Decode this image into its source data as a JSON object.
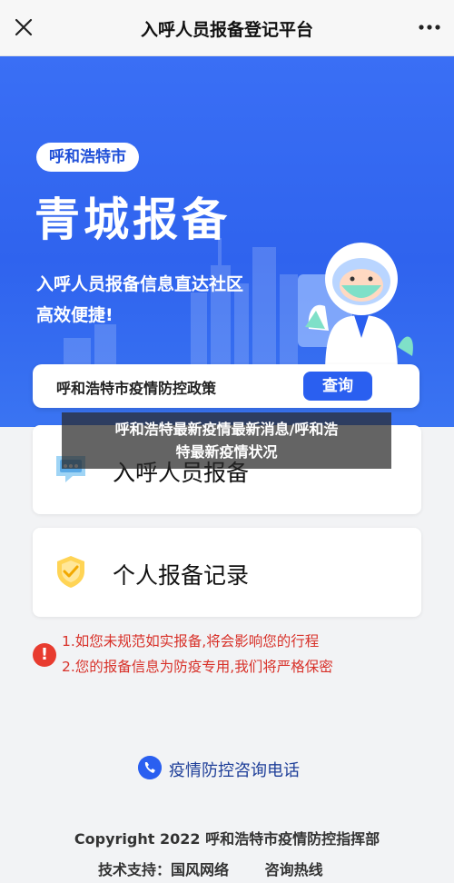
{
  "topbar": {
    "title": "入呼人员报备登记平台"
  },
  "hero": {
    "city_tag": "呼和浩特市",
    "title": "青城报备",
    "subtitle_1": "入呼人员报备信息直达社区",
    "subtitle_2": "高效便捷!"
  },
  "policy": {
    "label": "呼和浩特市疫情防控政策",
    "button": "查询"
  },
  "overlay": {
    "line1": "呼和浩特最新疫情最新消息/呼和浩",
    "line2": "特最新疫情状况"
  },
  "cards": [
    {
      "label": "入呼人员报备",
      "icon": "chat-icon"
    },
    {
      "label": "个人报备记录",
      "icon": "shield-check-icon"
    }
  ],
  "notice": {
    "line1": "1.如您未规范如实报备,将会影响您的行程",
    "line2": "2.您的报备信息为防疫专用,我们将严格保密"
  },
  "hotline": {
    "label": "疫情防控咨询电话"
  },
  "footer": {
    "copyright": "Copyright 2022 呼和浩特市疫情防控指挥部",
    "tech": "技术支持：国风网络",
    "consult": "咨询热线"
  },
  "colors": {
    "primary": "#2a5ff0",
    "warn": "#e83b2f"
  }
}
